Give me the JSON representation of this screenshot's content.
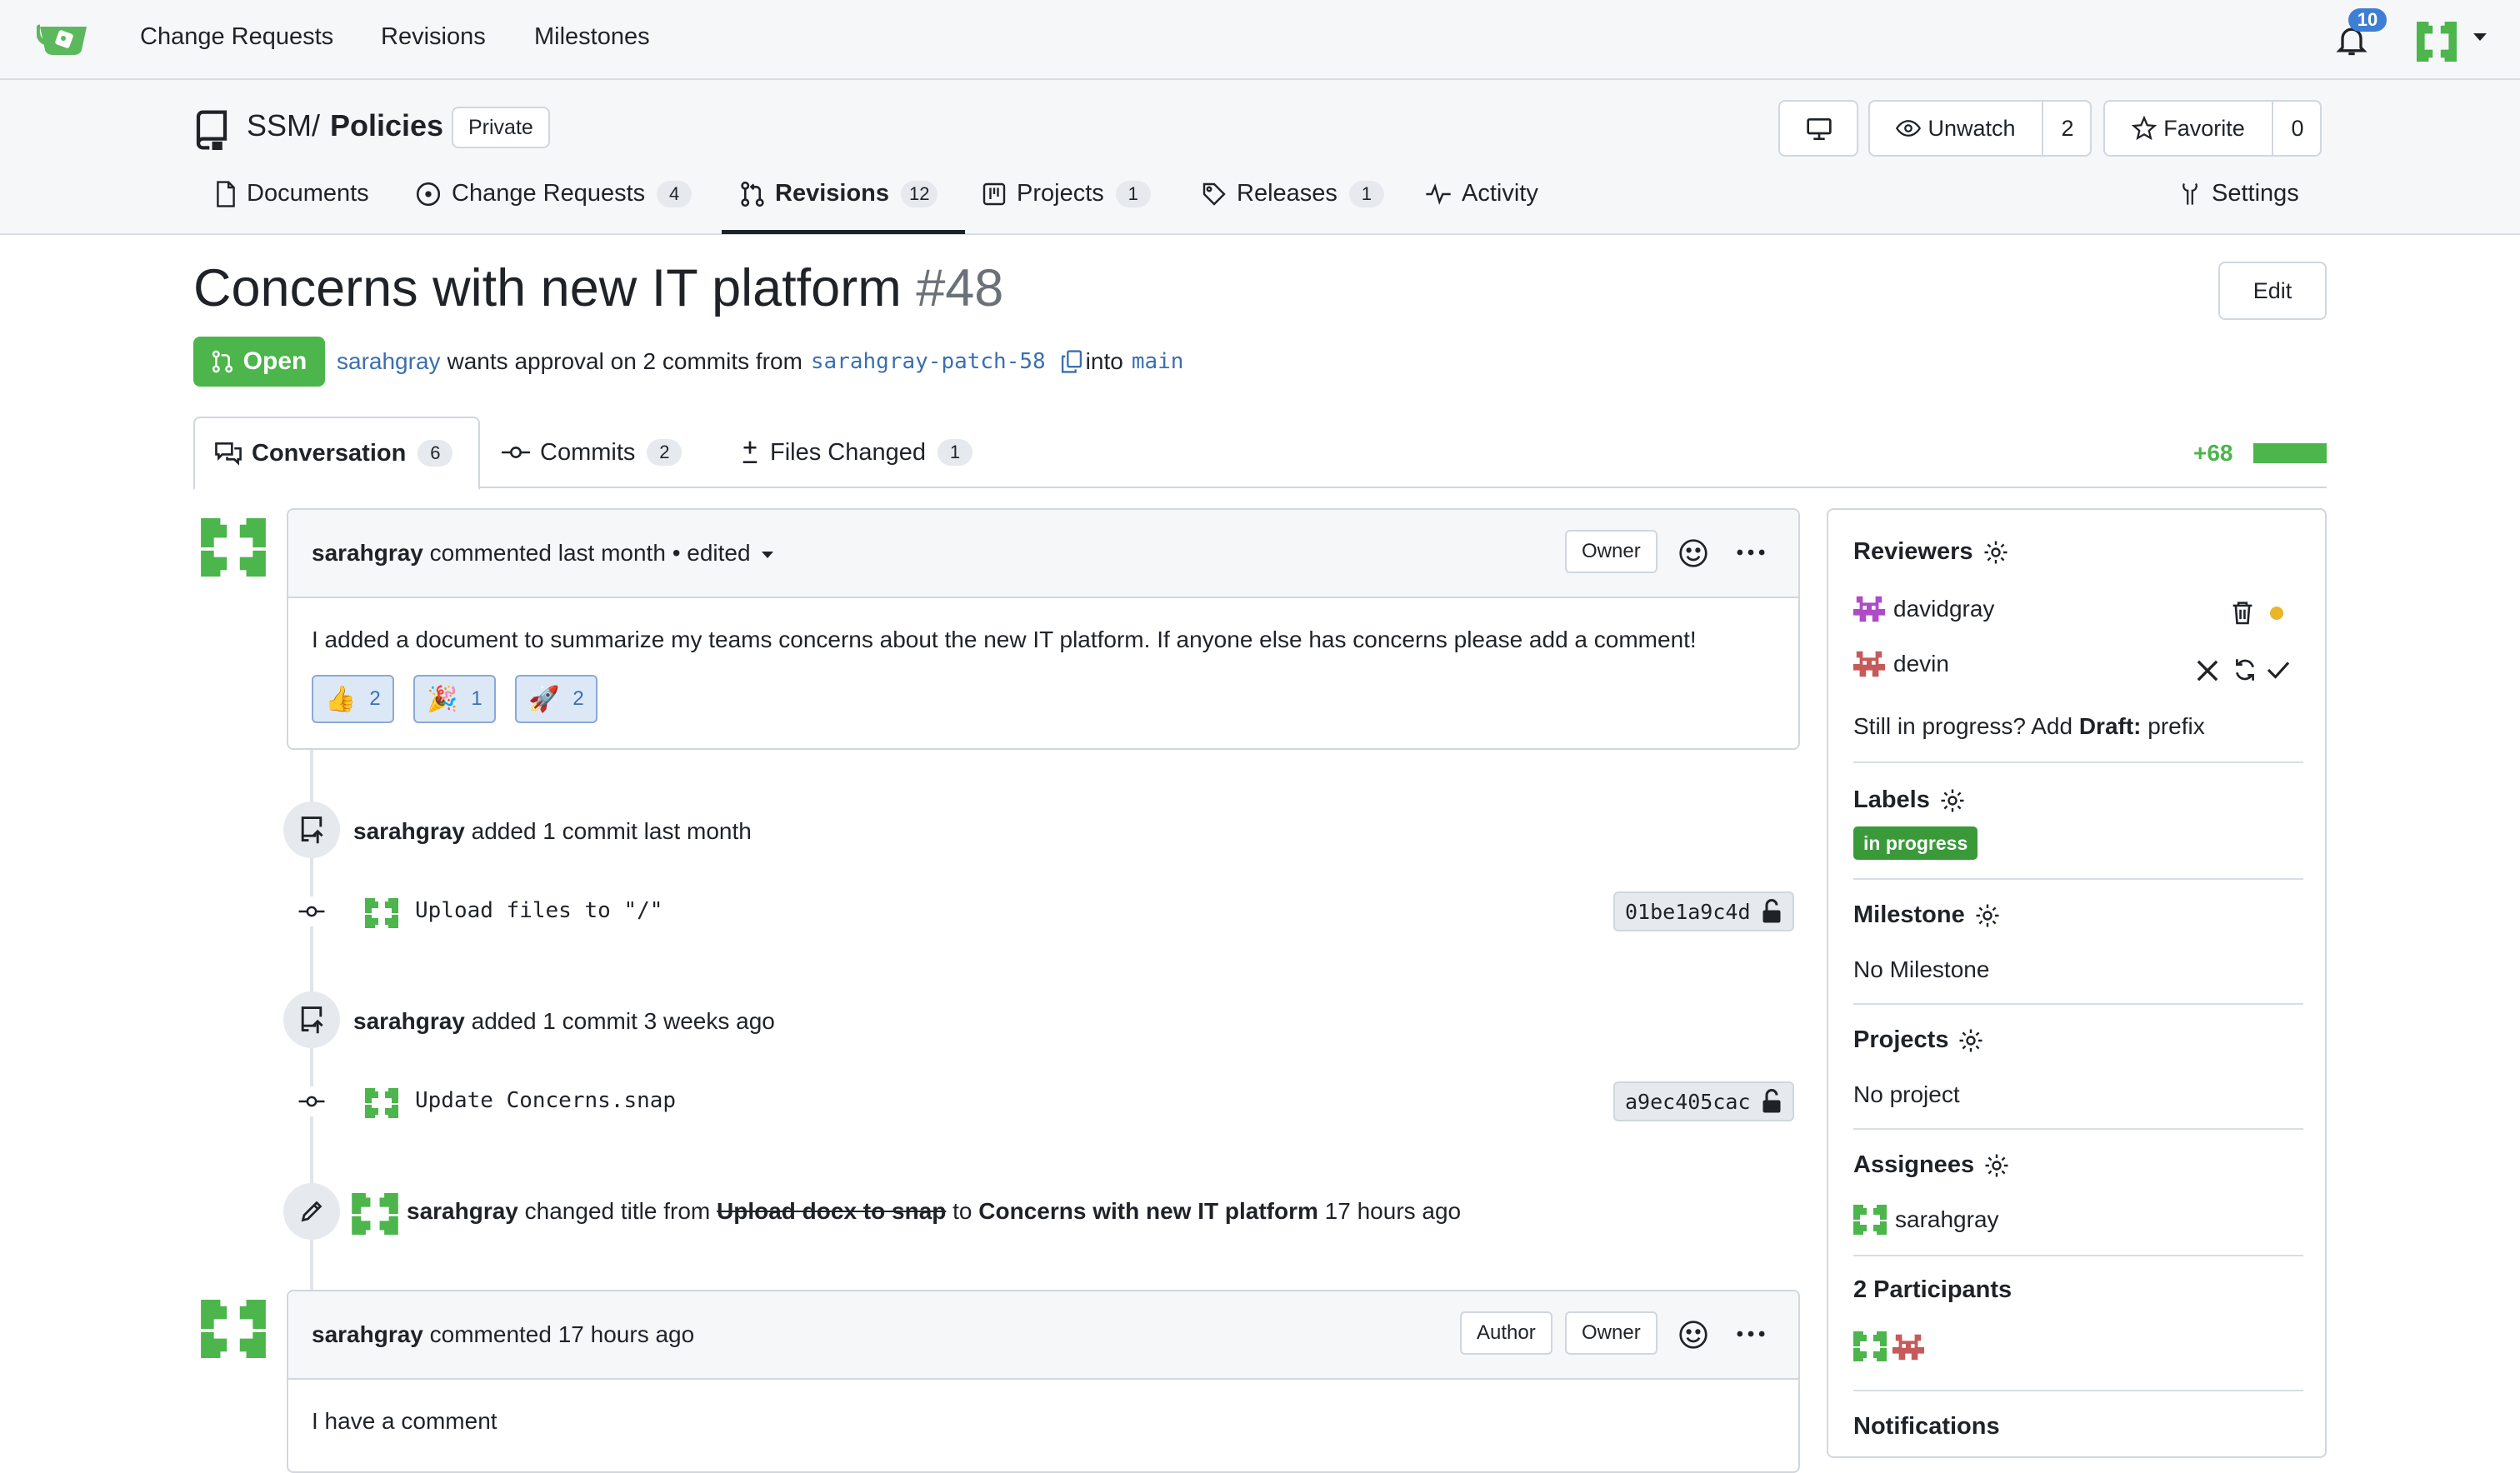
{
  "topnav": {
    "links": [
      "Change Requests",
      "Revisions",
      "Milestones"
    ],
    "notification_count": "10"
  },
  "repo": {
    "owner": "SSM",
    "separator": "/",
    "name": "Policies",
    "visibility": "Private",
    "unwatch_label": "Unwatch",
    "watch_count": "2",
    "favorite_label": "Favorite",
    "favorite_count": "0",
    "tabs": [
      {
        "label": "Documents",
        "icon": "document-icon"
      },
      {
        "label": "Change Requests",
        "count": "4",
        "icon": "issue-circle-icon"
      },
      {
        "label": "Revisions",
        "count": "12",
        "icon": "pull-request-icon",
        "active": true
      },
      {
        "label": "Projects",
        "count": "1",
        "icon": "project-board-icon"
      },
      {
        "label": "Releases",
        "count": "1",
        "icon": "tag-icon"
      },
      {
        "label": "Activity",
        "icon": "pulse-icon"
      },
      {
        "label": "Settings",
        "icon": "tools-icon"
      }
    ]
  },
  "pr": {
    "title": "Concerns with new IT platform",
    "number": "#48",
    "edit_label": "Edit",
    "state": "Open",
    "author": "sarahgray",
    "summary_mid": "wants approval on 2 commits from",
    "head_branch": "sarahgray-patch-58",
    "into": "into",
    "base_branch": "main"
  },
  "convtabs": [
    {
      "label": "Conversation",
      "count": "6",
      "icon": "comment-discussion-icon"
    },
    {
      "label": "Commits",
      "count": "2",
      "icon": "commit-icon"
    },
    {
      "label": "Files Changed",
      "count": "1",
      "icon": "diff-icon"
    }
  ],
  "diffstat": "+68",
  "timeline": {
    "comment1": {
      "author": "sarahgray",
      "meta": "commented last month",
      "edited": "• edited",
      "role": "Owner",
      "body": "I added a document to summarize my teams concerns about the new IT platform. If anyone else has concerns please add a comment!",
      "reactions": [
        {
          "emoji": "👍",
          "count": "2"
        },
        {
          "emoji": "🎉",
          "count": "1"
        },
        {
          "emoji": "🚀",
          "count": "2"
        }
      ]
    },
    "push1": {
      "author": "sarahgray",
      "text": "added 1 commit last month"
    },
    "commit1": {
      "message": "Upload files to \"/\"",
      "sha": "01be1a9c4d"
    },
    "push2": {
      "author": "sarahgray",
      "text": "added 1 commit 3 weeks ago"
    },
    "commit2": {
      "message": "Update Concerns.snap",
      "sha": "a9ec405cac"
    },
    "rename": {
      "author": "sarahgray",
      "text1": "changed title from",
      "old_title": "Upload docx to snap",
      "text2": "to",
      "new_title": "Concerns with new IT platform",
      "time": "17 hours ago"
    },
    "comment2": {
      "author": "sarahgray",
      "meta": "commented 17 hours ago",
      "role1": "Author",
      "role2": "Owner",
      "body": "I have a comment"
    }
  },
  "sidebar": {
    "reviewers_title": "Reviewers",
    "reviewers": [
      {
        "name": "davidgray"
      },
      {
        "name": "devin"
      }
    ],
    "draft_text_a": "Still in progress? Add",
    "draft_text_b": "Draft:",
    "draft_text_c": "prefix",
    "labels_title": "Labels",
    "label": "in progress",
    "milestone_title": "Milestone",
    "milestone_value": "No Milestone",
    "projects_title": "Projects",
    "projects_value": "No project",
    "assignees_title": "Assignees",
    "assignee": "sarahgray",
    "participants_title": "2 Participants",
    "notifications_title": "Notifications"
  },
  "colors": {
    "accent_green": "#4cb54c",
    "link_blue": "#3a6fb0",
    "badge_blue": "#3f7ed5",
    "pending_dot": "#e9b52b"
  }
}
